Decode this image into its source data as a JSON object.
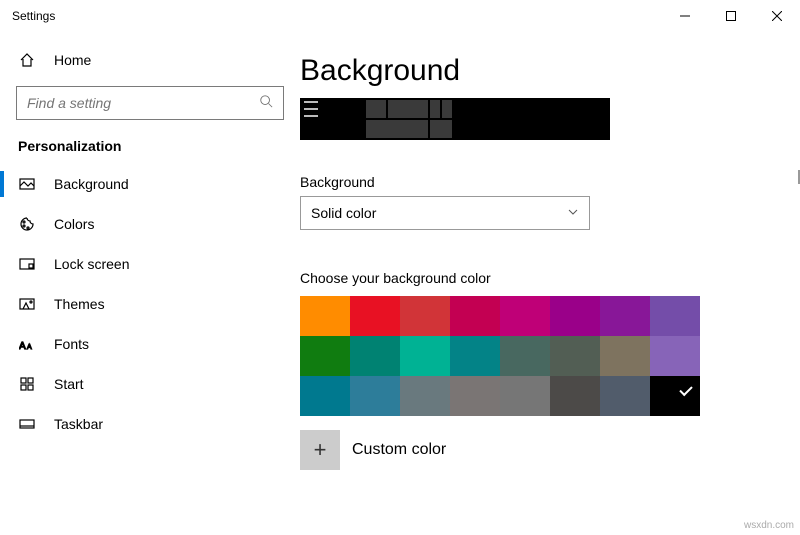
{
  "window": {
    "title": "Settings"
  },
  "sidebar": {
    "home": "Home",
    "search_placeholder": "Find a setting",
    "category": "Personalization",
    "items": [
      {
        "label": "Background",
        "icon": "picture-icon"
      },
      {
        "label": "Colors",
        "icon": "palette-icon"
      },
      {
        "label": "Lock screen",
        "icon": "lock-screen-icon"
      },
      {
        "label": "Themes",
        "icon": "themes-icon"
      },
      {
        "label": "Fonts",
        "icon": "fonts-icon"
      },
      {
        "label": "Start",
        "icon": "start-icon"
      },
      {
        "label": "Taskbar",
        "icon": "taskbar-icon"
      }
    ]
  },
  "main": {
    "title": "Background",
    "dropdown_label": "Background",
    "dropdown_value": "Solid color",
    "swatch_label": "Choose your background color",
    "custom_label": "Custom color",
    "colors_row1": [
      "#ff8c00",
      "#e81123",
      "#d13438",
      "#c30052",
      "#bf0077",
      "#9a0089",
      "#881798",
      "#744da9"
    ],
    "colors_row2": [
      "#107c10",
      "#008272",
      "#00b294",
      "#038387",
      "#486860",
      "#525e54",
      "#7e735f",
      "#8764b8"
    ],
    "colors_row3": [
      "#00798f",
      "#2d7d9a",
      "#69797e",
      "#7a7574",
      "#767676",
      "#4c4a48",
      "#515c6b",
      "#000000"
    ],
    "selected_color": "#000000"
  },
  "watermark": "wsxdn.com"
}
